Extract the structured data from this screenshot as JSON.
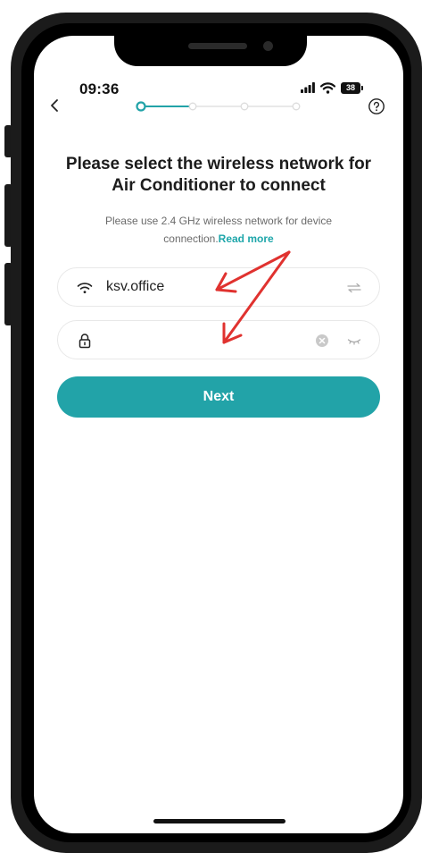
{
  "status_bar": {
    "time": "09:36",
    "battery": "38"
  },
  "header": {
    "back_icon": "chevron-left-icon",
    "help_icon": "question-circle-icon",
    "steps_total": 4,
    "steps_current": 1
  },
  "content": {
    "title": "Please select the wireless network for Air Conditioner to connect",
    "subtitle": "Please use 2.4 GHz wireless network for device connection.",
    "read_more": "Read more"
  },
  "wifi_field": {
    "icon": "wifi-icon",
    "value": "ksv.office",
    "switch_icon": "swap-arrows-icon"
  },
  "password_field": {
    "icon": "lock-icon",
    "value": "",
    "placeholder": "",
    "clear_icon": "clear-circle-icon",
    "visibility_icon": "eye-closed-icon"
  },
  "next_button": {
    "label": "Next"
  },
  "colors": {
    "accent": "#22a3a8",
    "link": "#1ea6aa",
    "annotation_arrow": "#e0322f"
  }
}
